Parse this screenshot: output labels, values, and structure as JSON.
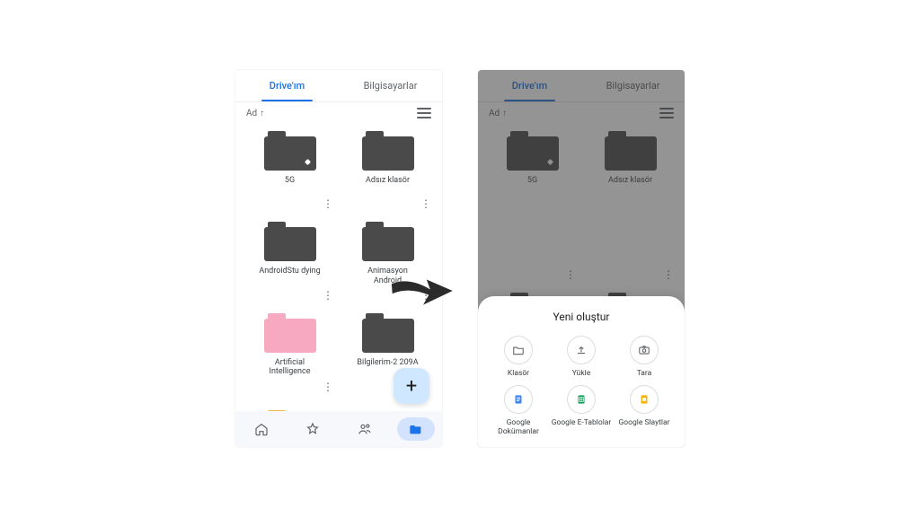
{
  "tabs": {
    "my_drive": "Drive'ım",
    "computers": "Bilgisayarlar"
  },
  "sort": {
    "label": "Ad",
    "direction_glyph": "↑"
  },
  "folders": [
    {
      "name": "5G",
      "color": "gray",
      "starred": true
    },
    {
      "name": "Adsız klasör",
      "color": "gray"
    },
    {
      "name": "AndroidStu\ndying",
      "color": "gray"
    },
    {
      "name": "Animasyon\nAndroid",
      "color": "gray"
    },
    {
      "name": "Artificial\nIntelligence",
      "color": "pink"
    },
    {
      "name": "Bilgilerim-2\n209A",
      "color": "gray"
    }
  ],
  "extra_folder": {
    "name": "",
    "color": "yellow"
  },
  "fab_glyph": "+",
  "sheet": {
    "title": "Yeni oluştur",
    "row1": [
      {
        "key": "folder",
        "label": "Klasör"
      },
      {
        "key": "upload",
        "label": "Yükle"
      },
      {
        "key": "scan",
        "label": "Tara"
      }
    ],
    "row2": [
      {
        "key": "docs",
        "label": "Google Dokümanlar",
        "color": "#4285f4"
      },
      {
        "key": "sheets",
        "label": "Google E-Tablolar",
        "color": "#0f9d58"
      },
      {
        "key": "slides",
        "label": "Google Slaytlar",
        "color": "#f4b400"
      }
    ]
  }
}
